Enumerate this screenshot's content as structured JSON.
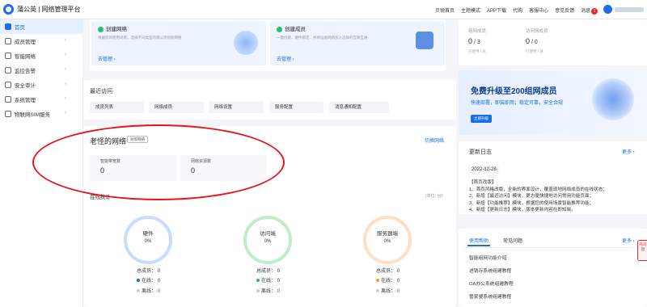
{
  "brand": {
    "name": "蒲公英 | 网络管理平台"
  },
  "topnav": [
    "贝锐首页",
    "主题模式",
    "APP下载",
    "代购",
    "客服中心",
    "意见反馈",
    "消息"
  ],
  "message_count": "1",
  "sidebar": {
    "items": [
      {
        "label": "首页",
        "active": true,
        "arrow": false
      },
      {
        "label": "成员管理",
        "active": false,
        "arrow": true
      },
      {
        "label": "智能网络",
        "active": false,
        "arrow": true
      },
      {
        "label": "监控告警",
        "active": false,
        "arrow": true
      },
      {
        "label": "安全审计",
        "active": false,
        "arrow": true
      },
      {
        "label": "系统管理",
        "active": false,
        "arrow": true
      },
      {
        "label": "物联网SIM服务",
        "active": false,
        "arrow": true
      }
    ]
  },
  "create_network": {
    "title": "创建网络",
    "desc": "根据您的使用场景，选择不同类型的蒲公英智能网络",
    "link": "去管理 ›"
  },
  "create_member": {
    "title": "创建成员",
    "desc": "一键创建、硬件绑定、并将设备网络加入选择的互联互通",
    "link": "去管理 ›"
  },
  "stats": {
    "members_label": "组网成员",
    "members_value": "0",
    "members_total": "/ 3",
    "visitors_label": "访问网成员",
    "visitors_value": "0",
    "visitors_total": "/ 0",
    "used_label": "已使用 / 总",
    "used_label2": "已使用 / 总"
  },
  "recent": {
    "title": "最近访问",
    "items": [
      "成员列表",
      "网络成员",
      "网络设置",
      "服务配置",
      "消息通知配置"
    ]
  },
  "network": {
    "title": "老怪的网络",
    "tag": "对等网络",
    "switch": "切换网络",
    "smart_label": "智能带宽数",
    "smart_value": "0",
    "res_label": "网络资源数",
    "res_value": "0",
    "section_label": "在线统计",
    "unit": "(单位: 台)"
  },
  "rings": [
    {
      "label": "硬件",
      "pct": "0%",
      "total_label": "总成员：",
      "total": "0",
      "online_label": "在线：",
      "online": "0",
      "offline_label": "离线：",
      "offline": "0",
      "color": "#c9dcfb",
      "dot_on": "#1a6fe6"
    },
    {
      "label": "访问端",
      "pct": "0%",
      "total_label": "总成员：",
      "total": "0",
      "online_label": "在线：",
      "online": "0",
      "offline_label": "离线：",
      "offline": "0",
      "color": "#bfeccc",
      "dot_on": "#23c16b"
    },
    {
      "label": "服务器端",
      "pct": "0%",
      "total_label": "总成员：",
      "total": "0",
      "online_label": "在线：",
      "online": "0",
      "offline_label": "离线：",
      "offline": "0",
      "color": "#fde0c4",
      "dot_on": "#f59a23"
    }
  ],
  "promo": {
    "title": "免费升级至200组网成员",
    "subtitle": "快速部署，即装即用；稳定可靠，安全合规",
    "button": "立即升级"
  },
  "changelog": {
    "title": "更新日志",
    "more": "更多 ›",
    "date": "2022-12-28",
    "lines": [
      "【首页改版】",
      "1、首页风格改版，全新的界面设计，覆盖现地网络成员的在线状态；",
      "2、新增【最近访问】模块，更方便快捷地访问常用功能页面；",
      "3、新增【功能推荐】模块，根据您的使用场景智能推荐功能；",
      "4、新增【更新日志】模块，版本更新内容在即知晓。"
    ]
  },
  "help": {
    "tab_active": "使用帮助",
    "tab_other": "常见问题",
    "more": "更多 ›",
    "items": [
      "智能组网功能介绍",
      "进销存系统组建教程",
      "OA办公系统组建教程",
      "管家婆系统组建教程"
    ]
  },
  "float_badge": "有问题"
}
